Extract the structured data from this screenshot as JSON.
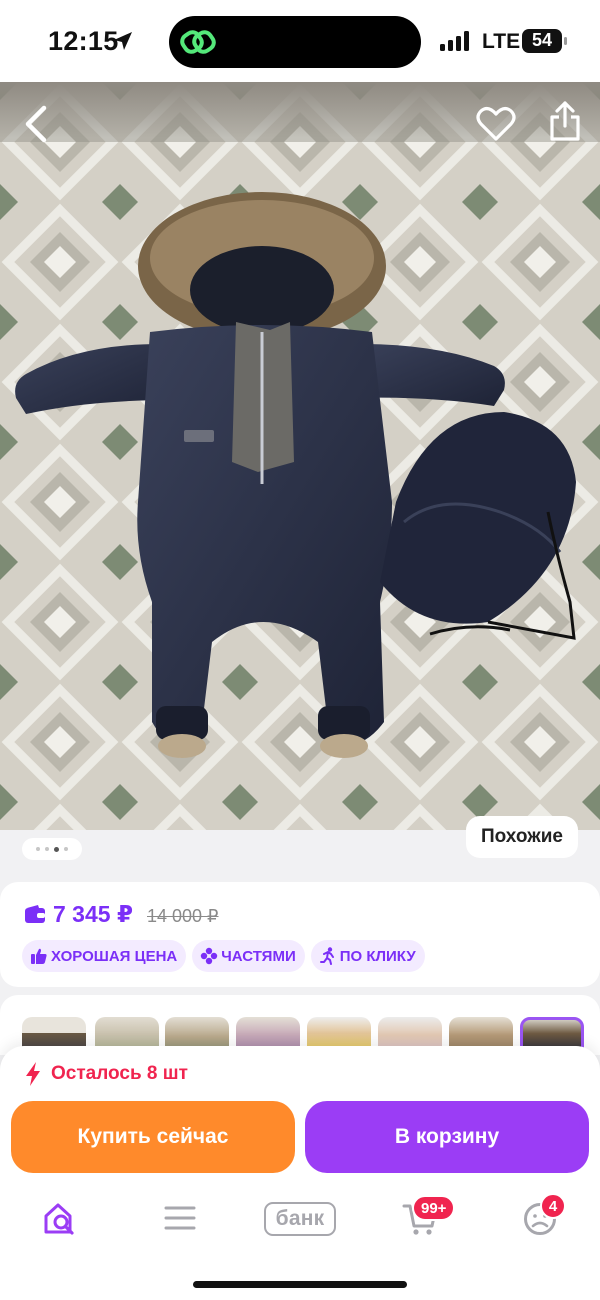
{
  "status_bar": {
    "time": "12:15",
    "network": "LTE",
    "battery": "54"
  },
  "header": {
    "icons": [
      "back-chevron-icon",
      "heart-icon",
      "share-icon"
    ]
  },
  "gallery": {
    "similar_label": "Похожие",
    "total_dots": 4,
    "active_dot": 2
  },
  "price": {
    "current": "7 345 ₽",
    "old": "14 000 ₽"
  },
  "badges": [
    {
      "label": "ХОРОШАЯ ЦЕНА",
      "icon": "thumbs-up-icon"
    },
    {
      "label": "ЧАСТЯМИ",
      "icon": "parts-icon"
    },
    {
      "label": "ПО КЛИКУ",
      "icon": "running-person-icon"
    }
  ],
  "stock": {
    "text": "Осталось 8 шт"
  },
  "actions": {
    "buy_now": "Купить сейчас",
    "add_to_cart": "В корзину"
  },
  "bottom_nav": {
    "bank_label": "банк",
    "cart_badge": "99+",
    "profile_badge": "4"
  },
  "colors": {
    "accent_purple": "#9b3df5",
    "price_purple": "#7b2ff7",
    "buy_orange": "#ff8a2b",
    "alert_red": "#f0244f"
  }
}
